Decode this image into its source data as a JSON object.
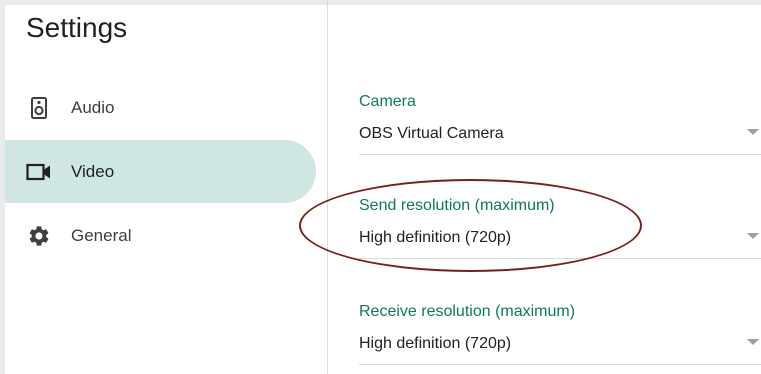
{
  "page": {
    "title": "Settings"
  },
  "nav": {
    "items": [
      {
        "label": "Audio",
        "icon": "speaker-icon",
        "active": false
      },
      {
        "label": "Video",
        "icon": "video-camera-icon",
        "active": true
      },
      {
        "label": "General",
        "icon": "gear-icon",
        "active": false
      }
    ]
  },
  "fields": {
    "camera": {
      "label": "Camera",
      "value": "OBS Virtual Camera"
    },
    "send_resolution": {
      "label": "Send resolution (maximum)",
      "value": "High definition (720p)"
    },
    "receive_resolution": {
      "label": "Receive resolution (maximum)",
      "value": "High definition (720p)"
    }
  },
  "colors": {
    "accent": "#0b7a5c",
    "active_nav_bg": "#cfe6e3",
    "annotation": "#7a1f1a"
  }
}
